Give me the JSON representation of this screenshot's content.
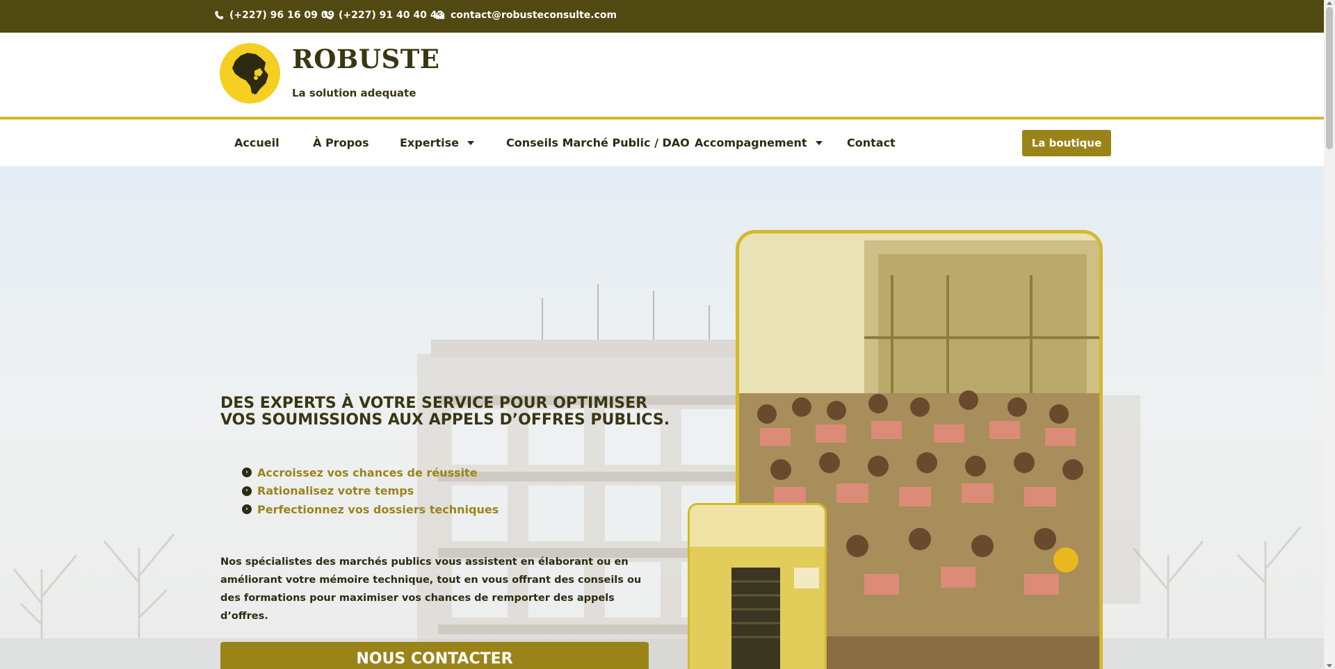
{
  "topbar": {
    "phone1": "(+227) 96 16 09 09",
    "phone2": "(+227) 91 40 40 43",
    "email": "contact@robusteconsulte.com"
  },
  "header": {
    "brand": "ROBUSTE",
    "tagline": "La solution adequate"
  },
  "nav": {
    "items": [
      {
        "label": "Accueil"
      },
      {
        "label": "À Propos"
      },
      {
        "label": "Expertise"
      },
      {
        "label": "Conseils Marché Public / DAO"
      },
      {
        "label": "Accompagnement"
      },
      {
        "label": "Contact"
      }
    ],
    "shop_label": "La boutique"
  },
  "hero": {
    "title": "DES EXPERTS À VOTRE SERVICE POUR OPTIMISER VOS SOUMISSIONS AUX APPELS D’OFFRES PUBLICS.",
    "bullets": [
      "Accroissez vos chances de réussite",
      "Rationalisez votre temps",
      "Perfectionnez vos dossiers techniques"
    ],
    "description": "Nos spécialistes des marchés publics vous assistent en élaborant ou en améliorant votre mémoire technique, tout en vous offrant des conseils ou des formations pour maximiser vos chances de remporter des appels d’offres.",
    "cta_label": "NOUS CONTACTER"
  },
  "colors": {
    "topbar_bg": "#514912",
    "accent": "#9a8419",
    "gold_border": "#d4b82a",
    "logo_yellow": "#f5cf21",
    "dark_text": "#2c2c14"
  },
  "icons": [
    "phone-icon",
    "envelope-icon",
    "chevron-circle-right-icon",
    "caret-down-icon",
    "africa-rhino-logo"
  ]
}
